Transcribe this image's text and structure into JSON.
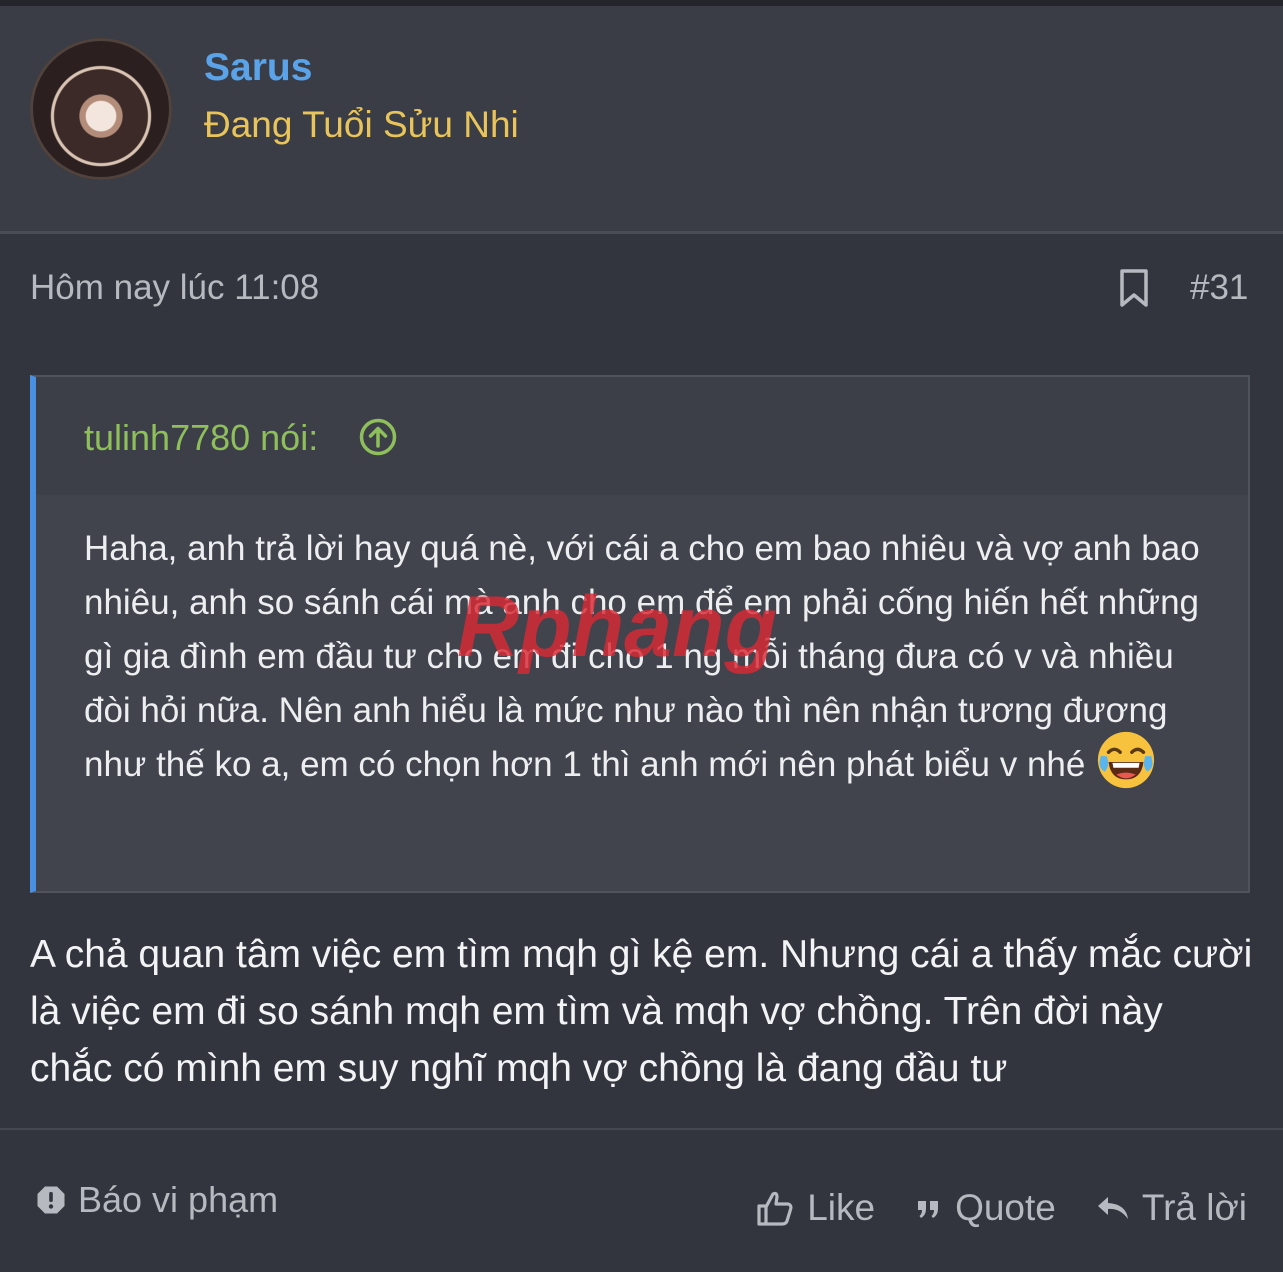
{
  "post": {
    "author": {
      "name": "Sarus",
      "title": "Đang Tuổi Sửu Nhi",
      "avatar_icon": "avatar-photo"
    },
    "timestamp": "Hôm nay lúc 11:08",
    "post_number": "#31",
    "bookmark_icon": "bookmark-icon",
    "quote": {
      "author_label": "tulinh7780 nói:",
      "up_icon": "arrow-up-circle-icon",
      "text": "Haha, anh trả lời hay quá nè, với cái a cho em bao nhiêu và vợ anh bao nhiêu, anh so sánh cái mà anh cho em để em phải cống hiến hết những gì gia đình em đầu tư cho em đi cho 1 ng mỗi tháng đưa có v và nhiều đòi hỏi nữa. Nên anh hiểu là mức như nào thì nên nhận tương đương như thế ko a, em có chọn hơn 1 thì anh mới nên phát biểu v nhé",
      "emoji": "face-with-tears-of-joy"
    },
    "watermark": "Rphang",
    "body": "A chả quan tâm việc em tìm mqh gì kệ em. Nhưng cái a thấy mắc cười là việc em đi so sánh mqh em tìm và mqh vợ chồng. Trên đời này chắc có mình em suy nghĩ mqh vợ chồng là đang đầu tư"
  },
  "actions": {
    "report": "Báo vi phạm",
    "like": "Like",
    "quote": "Quote",
    "reply": "Trả lời"
  },
  "colors": {
    "background": "#32353d",
    "username": "#5aa3e8",
    "usertitle": "#e8c45a",
    "quote_author": "#8fbf5a",
    "quote_border": "#4a90e2"
  }
}
